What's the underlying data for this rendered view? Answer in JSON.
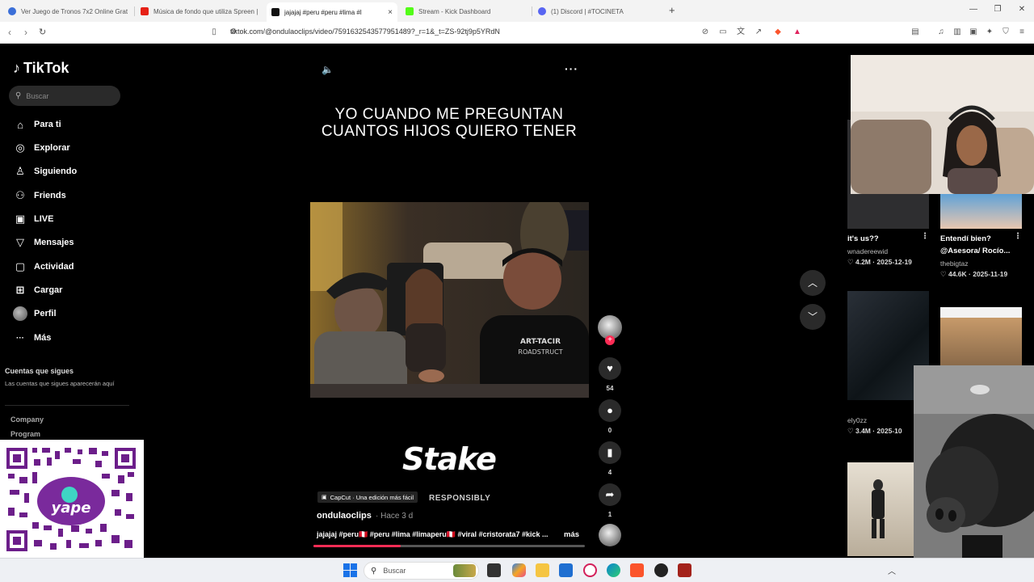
{
  "browser": {
    "tabs": [
      {
        "label": "Ver Juego de Tronos 7x2 Online Grat",
        "color": "#3b6fd8",
        "active": false
      },
      {
        "label": "Música de fondo que utiliza Spreen |",
        "color": "#e62117",
        "active": false
      },
      {
        "label": "jajajaj #peru #peru #lima #l",
        "color": "#111111",
        "active": true
      },
      {
        "label": "Stream - Kick Dashboard",
        "color": "#53fc18",
        "active": false
      },
      {
        "label": "(1) Discord | #TOCINETA",
        "color": "#5865f2",
        "active": false
      }
    ],
    "tab_close": "×",
    "new_tab": "+",
    "url": "tiktok.com/@ondulaoclips/video/7591632543577951489?_r=1&_t=ZS-92tj9p5YRdN",
    "window_controls": [
      "—",
      "❐",
      "✕"
    ]
  },
  "sidebar": {
    "logo": "TikTok",
    "search_placeholder": "Buscar",
    "nav": [
      {
        "label": "Para ti",
        "icon": "home-icon",
        "glyph": "⌂"
      },
      {
        "label": "Explorar",
        "icon": "compass-icon",
        "glyph": "◎"
      },
      {
        "label": "Siguiendo",
        "icon": "following-icon",
        "glyph": "♙"
      },
      {
        "label": "Friends",
        "icon": "friends-icon",
        "glyph": "⚇"
      },
      {
        "label": "LIVE",
        "icon": "live-icon",
        "glyph": "▣"
      },
      {
        "label": "Mensajes",
        "icon": "messages-icon",
        "glyph": "▽"
      },
      {
        "label": "Actividad",
        "icon": "activity-icon",
        "glyph": "▢"
      },
      {
        "label": "Cargar",
        "icon": "upload-icon",
        "glyph": "⊞"
      },
      {
        "label": "Perfil",
        "icon": "profile-avatar",
        "glyph": ""
      },
      {
        "label": "Más",
        "icon": "more-icon",
        "glyph": "···"
      }
    ],
    "following_title": "Cuentas que sigues",
    "following_desc": "Las cuentas que sigues aparecerán aquí",
    "footer_links": [
      "Company",
      "Program"
    ]
  },
  "video": {
    "caption": "YO CUANDO ME PREGUNTAN CUANTOS HIJOS QUIERO TENER",
    "watermark": "Stake",
    "watermark_sub": "RESPONSIBLY",
    "capcut_badge": "CapCut · Una edición más fácil",
    "author": "ondulaoclips",
    "posted": "· Hace 3 d",
    "tags": "jajajaj #peru🇵🇪 #peru #lima #limaperu🇵🇪 #viral #cristorata7 #kick ...",
    "more_label": "más",
    "progress": 0.32,
    "more_dots": "···",
    "mute_icon": "🔈"
  },
  "actions": {
    "likes": "54",
    "comments": "0",
    "saves": "4",
    "shares": "1",
    "follow_plus": "+"
  },
  "right": {
    "items": [
      {
        "title": "it's us??",
        "author": "wnadereewid",
        "stats": "♡ 4.2M · 2025-12-19"
      },
      {
        "title": "Entendí bien? @Asesora/ Rocío...",
        "author": "thebigtaz",
        "stats": "♡ 44.6K · 2025-11-19"
      },
      {
        "title": "",
        "author": "ely0zz",
        "stats": "♡ 3.4M · 2025-10"
      }
    ],
    "menu_glyph": "⋮"
  },
  "taskbar": {
    "search_placeholder": "Buscar"
  },
  "colors": {
    "accent": "#fe2c55",
    "bg": "#000000"
  }
}
